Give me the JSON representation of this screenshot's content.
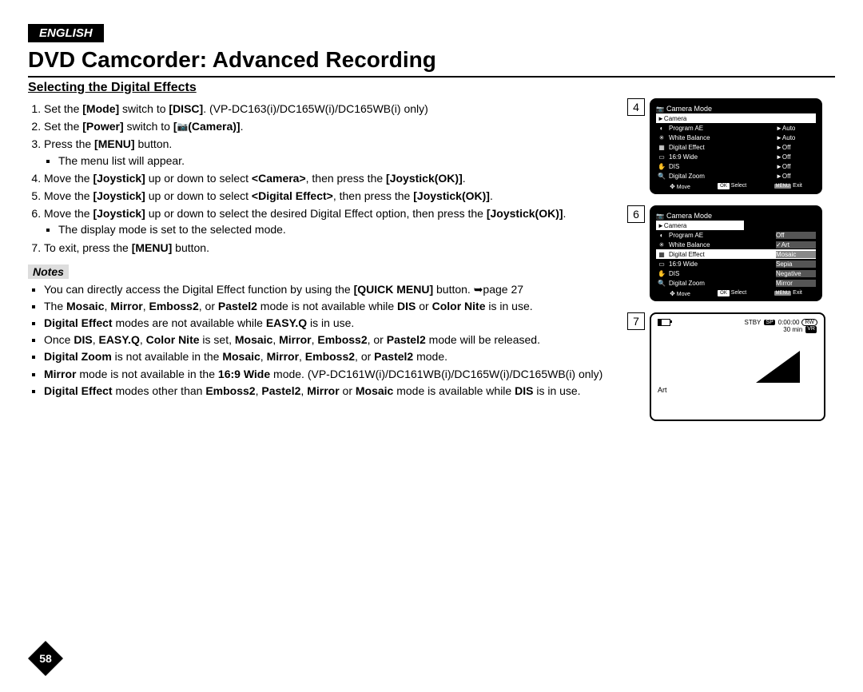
{
  "language": "ENGLISH",
  "title": "DVD Camcorder: Advanced Recording",
  "section": "Selecting the Digital Effects",
  "steps": {
    "s1a": "Set the ",
    "s1b": "[Mode]",
    "s1c": " switch to ",
    "s1d": "[DISC]",
    "s1e": ". (VP-DC163(i)/DC165W(i)/DC165WB(i) only)",
    "s2a": "Set the ",
    "s2b": "[Power]",
    "s2c": " switch to ",
    "s2d": "[",
    "s2e": "(Camera)]",
    "s2f": ".",
    "s3a": "Press the ",
    "s3b": "[MENU]",
    "s3c": " button.",
    "s3sub": "The menu list will appear.",
    "s4a": "Move the ",
    "s4b": "[Joystick]",
    "s4c": " up or down to select ",
    "s4d": "<Camera>",
    "s4e": ", then press the ",
    "s4f": "[Joystick(OK)]",
    "s4g": ".",
    "s5a": "Move the ",
    "s5b": "[Joystick]",
    "s5c": " up or down to select ",
    "s5d": "<Digital Effect>",
    "s5e": ", then press the ",
    "s5f": "[Joystick(OK)]",
    "s5g": ".",
    "s6a": "Move the ",
    "s6b": "[Joystick]",
    "s6c": " up or down to select the desired Digital Effect option, then press the ",
    "s6d": "[Joystick(OK)]",
    "s6e": ".",
    "s6sub": "The display mode is set to the selected mode.",
    "s7a": "To exit, press the ",
    "s7b": "[MENU]",
    "s7c": " button."
  },
  "notes_label": "Notes",
  "notes": {
    "n1a": "You can directly access the Digital Effect function by using the ",
    "n1b": "[QUICK MENU]",
    "n1c": " button. ➥page 27",
    "n2a": "The ",
    "n2b": "Mosaic",
    "n2c": ", ",
    "n2d": "Mirror",
    "n2e": ", ",
    "n2f": "Emboss2",
    "n2g": ", or ",
    "n2h": "Pastel2",
    "n2i": " mode is not available while ",
    "n2j": "DIS",
    "n2k": " or ",
    "n2l": "Color Nite",
    "n2m": " is in use.",
    "n3a": "Digital Effect",
    "n3b": " modes are not available while ",
    "n3c": "EASY.Q",
    "n3d": " is in use.",
    "n4a": "Once ",
    "n4b": "DIS",
    "n4c": ", ",
    "n4d": "EASY.Q",
    "n4e": ", ",
    "n4f": "Color Nite",
    "n4g": " is set, ",
    "n4h": "Mosaic",
    "n4i": ", ",
    "n4j": "Mirror",
    "n4k": ", ",
    "n4l": "Emboss2",
    "n4m": ", or ",
    "n4n": "Pastel2",
    "n4o": " mode will be released.",
    "n5a": "Digital Zoom",
    "n5b": " is not available in the ",
    "n5c": "Mosaic",
    "n5d": ", ",
    "n5e": "Mirror",
    "n5f": ", ",
    "n5g": "Emboss2",
    "n5h": ", or ",
    "n5i": "Pastel2",
    "n5j": " mode.",
    "n6a": "Mirror",
    "n6b": " mode is not available in the ",
    "n6c": "16:9 Wide",
    "n6d": " mode. (VP-DC161W(i)/DC161WB(i)/DC165W(i)/DC165WB(i) only)",
    "n7a": "Digital Effect",
    "n7b": " modes other than ",
    "n7c": "Emboss2",
    "n7d": ", ",
    "n7e": "Pastel2",
    "n7f": ", ",
    "n7g": "Mirror",
    "n7h": " or ",
    "n7i": "Mosaic",
    "n7j": " mode is available while ",
    "n7k": "DIS",
    "n7l": " is in use."
  },
  "figs": {
    "f4": "4",
    "f6": "6",
    "f7": "7",
    "cam_mode": "Camera Mode",
    "camera": "►Camera",
    "menu": [
      {
        "icon": "◐",
        "label": "Program AE",
        "val": "►Auto"
      },
      {
        "icon": "✳",
        "label": "White Balance",
        "val": "►Auto"
      },
      {
        "icon": "▦",
        "label": "Digital Effect",
        "val": "►Off"
      },
      {
        "icon": "▭",
        "label": "16:9 Wide",
        "val": "►Off"
      },
      {
        "icon": "✋",
        "label": "DIS",
        "val": "►Off"
      },
      {
        "icon": "🔍",
        "label": "Digital Zoom",
        "val": "►Off"
      }
    ],
    "menu6": [
      {
        "icon": "◐",
        "label": "Program AE",
        "val": "Off"
      },
      {
        "icon": "✳",
        "label": "White Balance",
        "val": "✓Art",
        "check": true
      },
      {
        "icon": "▦",
        "label": "Digital Effect",
        "val": "Mosaic",
        "sel": true
      },
      {
        "icon": "▭",
        "label": "16:9 Wide",
        "val": "Sepia"
      },
      {
        "icon": "✋",
        "label": "DIS",
        "val": "Negative"
      },
      {
        "icon": "🔍",
        "label": "Digital Zoom",
        "val": "Mirror"
      }
    ],
    "footer_move": "Move",
    "footer_select": "Select",
    "footer_exit": "Exit",
    "f7_stby": "STBY",
    "f7_sp": "SP",
    "f7_time": "0:00:00",
    "f7_rw": "RW",
    "f7_min": "30 min",
    "f7_vr": "VR",
    "f7_art": "Art"
  },
  "page": "58"
}
